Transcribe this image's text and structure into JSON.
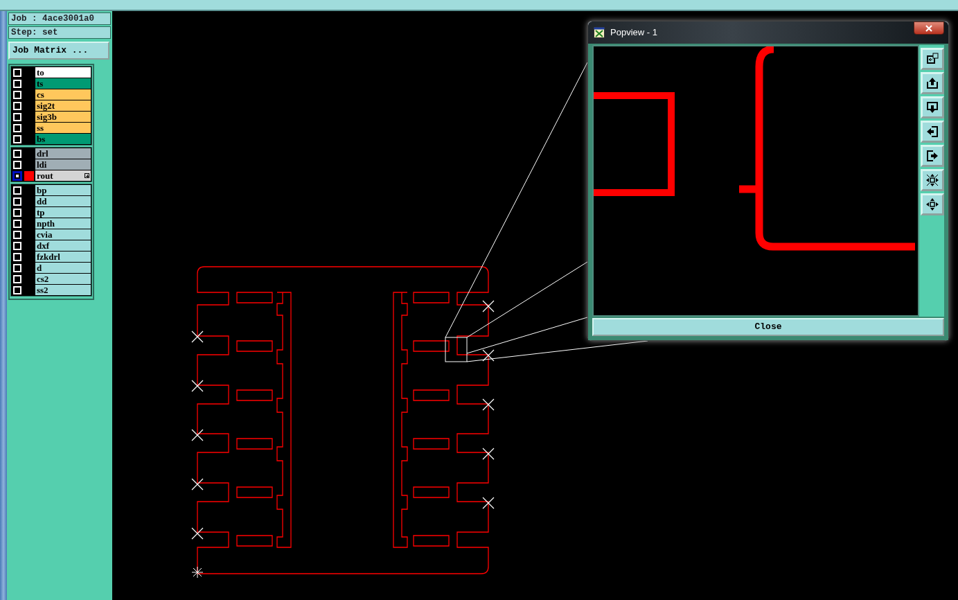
{
  "job": {
    "label": "Job : 4ace3001a0",
    "step": "Step: set",
    "matrix_button": "Job Matrix ..."
  },
  "layer_groups": [
    {
      "layers": [
        {
          "name": "to",
          "color": "#ffffff",
          "displayed": false,
          "affected": false
        },
        {
          "name": "ts",
          "color": "#009a73",
          "displayed": false,
          "affected": false
        },
        {
          "name": "cs",
          "color": "#ffc75c",
          "displayed": false,
          "affected": false
        },
        {
          "name": "sig2t",
          "color": "#ffc75c",
          "displayed": false,
          "affected": false
        },
        {
          "name": "sig3b",
          "color": "#ffc75c",
          "displayed": false,
          "affected": false
        },
        {
          "name": "ss",
          "color": "#ffc75c",
          "displayed": false,
          "affected": false
        },
        {
          "name": "bs",
          "color": "#009a73",
          "displayed": false,
          "affected": false
        }
      ]
    },
    {
      "layers": [
        {
          "name": "drl",
          "color": "#a0aeb5",
          "displayed": false,
          "affected": false
        },
        {
          "name": "ldi",
          "color": "#a0aeb5",
          "displayed": false,
          "affected": false
        },
        {
          "name": "rout",
          "color": "#d4d4d4",
          "displayed": true,
          "affected": true
        }
      ]
    },
    {
      "layers": [
        {
          "name": "bp",
          "color": "#a0dcdc",
          "displayed": false,
          "affected": false
        },
        {
          "name": "dd",
          "color": "#a0dcdc",
          "displayed": false,
          "affected": false
        },
        {
          "name": "tp",
          "color": "#a0dcdc",
          "displayed": false,
          "affected": false
        },
        {
          "name": "npth",
          "color": "#a0dcdc",
          "displayed": false,
          "affected": false
        },
        {
          "name": "cvia",
          "color": "#a0dcdc",
          "displayed": false,
          "affected": false
        },
        {
          "name": "dxf",
          "color": "#a0dcdc",
          "displayed": false,
          "affected": false
        },
        {
          "name": "fzkdrl",
          "color": "#a0dcdc",
          "displayed": false,
          "affected": false
        },
        {
          "name": "d",
          "color": "#a0dcdc",
          "displayed": false,
          "affected": false
        },
        {
          "name": "cs2",
          "color": "#a0dcdc",
          "displayed": false,
          "affected": false
        },
        {
          "name": "ss2",
          "color": "#a0dcdc",
          "displayed": false,
          "affected": false
        }
      ]
    }
  ],
  "popview": {
    "title": "Popview - 1",
    "close_button": "Close"
  }
}
